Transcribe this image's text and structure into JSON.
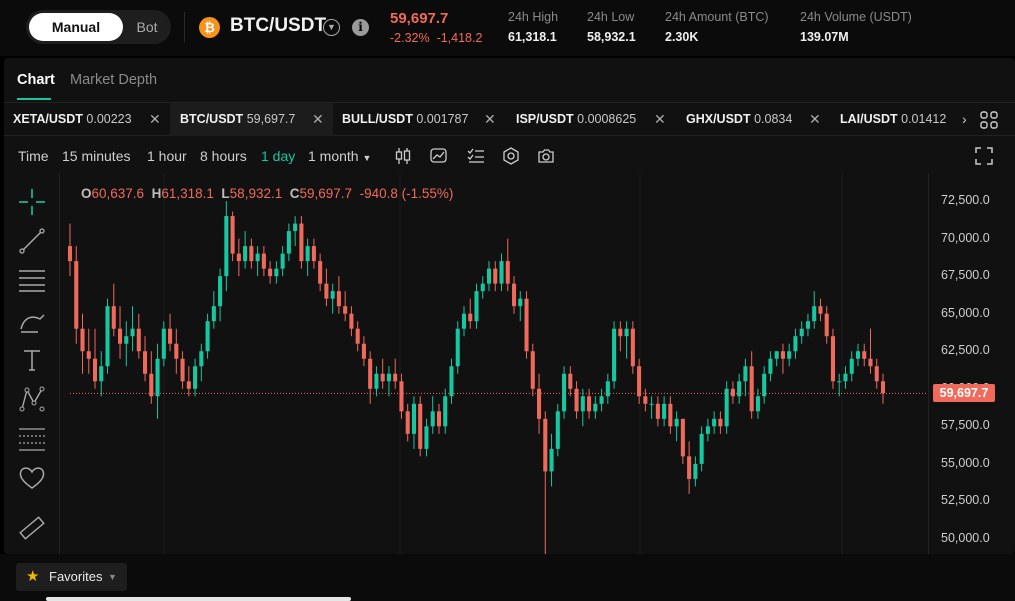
{
  "header": {
    "mode_toggle": {
      "manual": "Manual",
      "bot": "Bot"
    },
    "coin_glyph": "₿",
    "pair": "BTC/USDT",
    "last_price": "59,697.7",
    "change_pct": "-2.32%",
    "change_abs": "-1,418.2",
    "stats": [
      {
        "label": "24h High",
        "value": "61,318.1"
      },
      {
        "label": "24h Low",
        "value": "58,932.1"
      },
      {
        "label": "24h Amount (BTC)",
        "value": "2.30K"
      },
      {
        "label": "24h Volume (USDT)",
        "value": "139.07M"
      }
    ]
  },
  "view_tabs": {
    "chart": "Chart",
    "depth": "Market Depth"
  },
  "pair_tabs": [
    {
      "symbol": "XETA/USDT",
      "price": "0.00223",
      "active": false
    },
    {
      "symbol": "BTC/USDT",
      "price": "59,697.7",
      "active": true
    },
    {
      "symbol": "BULL/USDT",
      "price": "0.001787",
      "active": false
    },
    {
      "symbol": "ISP/USDT",
      "price": "0.0008625",
      "active": false
    },
    {
      "symbol": "GHX/USDT",
      "price": "0.0834",
      "active": false
    },
    {
      "symbol": "LAI/USDT",
      "price": "0.01412",
      "active": false
    }
  ],
  "toolbar": {
    "time_label": "Time",
    "timeframes": [
      "15 minutes",
      "1 hour",
      "8 hours",
      "1 day",
      "1 month"
    ],
    "active_timeframe": "1 day",
    "icons": [
      "candle-type-icon",
      "indicator-icon",
      "settings-list-icon",
      "gear-icon",
      "camera-icon",
      "fullscreen-icon"
    ]
  },
  "ohlc": {
    "o_label": "O",
    "o": "60,637.6",
    "h_label": "H",
    "h": "61,318.1",
    "l_label": "L",
    "l": "58,932.1",
    "c_label": "C",
    "c": "59,697.7",
    "chg": "-940.8 (-1.55%)"
  },
  "colors": {
    "up": "#16c8a0",
    "down": "#f06a5c",
    "accent": "#16c8a0",
    "bg": "#111111"
  },
  "price_axis": {
    "labels": [
      "72,500.0",
      "70,000.0",
      "67,500.0",
      "65,000.0",
      "62,500.0",
      "60,000.0",
      "57,500.0",
      "55,000.0",
      "52,500.0",
      "50,000.0"
    ],
    "current": "59,697.7",
    "current_value": 59697.7
  },
  "chart_data": {
    "type": "candlestick",
    "ylim": [
      49000,
      74300
    ],
    "candles": [
      [
        69500,
        71000,
        67500,
        68500
      ],
      [
        68500,
        69500,
        63000,
        64000
      ],
      [
        64000,
        65000,
        61000,
        62500
      ],
      [
        62500,
        64000,
        61000,
        62000
      ],
      [
        62000,
        64000,
        60000,
        60500
      ],
      [
        60500,
        62500,
        59500,
        61500
      ],
      [
        61500,
        66000,
        61000,
        65500
      ],
      [
        65500,
        67000,
        63500,
        64000
      ],
      [
        64000,
        65500,
        62000,
        63000
      ],
      [
        63000,
        64500,
        61500,
        63500
      ],
      [
        63500,
        65500,
        62500,
        64000
      ],
      [
        64000,
        65000,
        62000,
        62500
      ],
      [
        62500,
        63500,
        60500,
        61000
      ],
      [
        61000,
        62500,
        59000,
        59500
      ],
      [
        59500,
        63000,
        58000,
        62000
      ],
      [
        62000,
        64500,
        61500,
        64000
      ],
      [
        64000,
        65000,
        62500,
        63000
      ],
      [
        63000,
        64000,
        61000,
        62000
      ],
      [
        62000,
        62500,
        60000,
        60500
      ],
      [
        60500,
        61500,
        59500,
        60000
      ],
      [
        60000,
        62000,
        59500,
        61500
      ],
      [
        61500,
        63000,
        60500,
        62500
      ],
      [
        62500,
        65000,
        62000,
        64500
      ],
      [
        64500,
        66500,
        64000,
        65500
      ],
      [
        65500,
        68000,
        64500,
        67500
      ],
      [
        67500,
        72500,
        66500,
        71500
      ],
      [
        71500,
        71800,
        68500,
        69000
      ],
      [
        69000,
        70000,
        67500,
        68500
      ],
      [
        68500,
        70500,
        68000,
        69500
      ],
      [
        69500,
        70000,
        68000,
        68500
      ],
      [
        68500,
        69500,
        67500,
        69000
      ],
      [
        69000,
        69500,
        67500,
        68000
      ],
      [
        68000,
        68500,
        67000,
        67500
      ],
      [
        67500,
        68500,
        67000,
        68000
      ],
      [
        68000,
        69500,
        67500,
        69000
      ],
      [
        69000,
        71000,
        68500,
        70500
      ],
      [
        70500,
        71500,
        69500,
        71000
      ],
      [
        71000,
        71500,
        68000,
        68500
      ],
      [
        68500,
        70000,
        67500,
        69500
      ],
      [
        69500,
        70000,
        68000,
        68500
      ],
      [
        68500,
        69000,
        66500,
        67000
      ],
      [
        67000,
        68000,
        65500,
        66000
      ],
      [
        66000,
        67000,
        65000,
        66500
      ],
      [
        66500,
        67500,
        65000,
        65500
      ],
      [
        65500,
        66500,
        64500,
        65000
      ],
      [
        65000,
        65500,
        63500,
        64000
      ],
      [
        64000,
        64500,
        62500,
        63000
      ],
      [
        63000,
        63500,
        61500,
        62000
      ],
      [
        62000,
        62500,
        59000,
        60000
      ],
      [
        60000,
        61500,
        59500,
        61000
      ],
      [
        61000,
        62000,
        60000,
        60500
      ],
      [
        60500,
        61500,
        59500,
        61000
      ],
      [
        61000,
        62000,
        60000,
        60500
      ],
      [
        60500,
        61000,
        58000,
        58500
      ],
      [
        58500,
        59000,
        56500,
        57000
      ],
      [
        57000,
        59500,
        56000,
        59000
      ],
      [
        59000,
        59500,
        55500,
        56000
      ],
      [
        56000,
        58000,
        55500,
        57500
      ],
      [
        57500,
        59500,
        57000,
        58500
      ],
      [
        58500,
        59000,
        57000,
        57500
      ],
      [
        57500,
        60000,
        57000,
        59500
      ],
      [
        59500,
        62000,
        59000,
        61500
      ],
      [
        61500,
        64500,
        61000,
        64000
      ],
      [
        64000,
        65500,
        63500,
        65000
      ],
      [
        65000,
        66000,
        64000,
        64500
      ],
      [
        64500,
        67000,
        64000,
        66500
      ],
      [
        66500,
        67500,
        66000,
        67000
      ],
      [
        67000,
        68500,
        66500,
        68000
      ],
      [
        68000,
        68500,
        66500,
        67000
      ],
      [
        67000,
        69000,
        66500,
        68500
      ],
      [
        68500,
        70000,
        66500,
        67000
      ],
      [
        67000,
        67500,
        65000,
        65500
      ],
      [
        65500,
        66500,
        64500,
        66000
      ],
      [
        66000,
        66500,
        62000,
        62500
      ],
      [
        62500,
        63000,
        59500,
        60000
      ],
      [
        60000,
        61000,
        57000,
        58000
      ],
      [
        58000,
        58500,
        49000,
        54500
      ],
      [
        54500,
        57000,
        53500,
        56000
      ],
      [
        56000,
        59000,
        55500,
        58500
      ],
      [
        58500,
        61500,
        58000,
        61000
      ],
      [
        61000,
        61500,
        59500,
        60000
      ],
      [
        60000,
        60500,
        58000,
        58500
      ],
      [
        58500,
        60000,
        57500,
        59500
      ],
      [
        59500,
        60000,
        58000,
        58500
      ],
      [
        58500,
        59500,
        58000,
        59000
      ],
      [
        59000,
        60000,
        58500,
        59500
      ],
      [
        59500,
        61000,
        59000,
        60500
      ],
      [
        60500,
        64500,
        60000,
        64000
      ],
      [
        64000,
        64500,
        62500,
        63500
      ],
      [
        63500,
        64500,
        62000,
        64000
      ],
      [
        64000,
        64500,
        61000,
        61500
      ],
      [
        61500,
        62000,
        59000,
        59500
      ],
      [
        59500,
        60000,
        58500,
        59000
      ],
      [
        59000,
        59500,
        58000,
        59000
      ],
      [
        59000,
        59500,
        57500,
        58000
      ],
      [
        58000,
        59500,
        57500,
        59000
      ],
      [
        59000,
        59500,
        57000,
        57500
      ],
      [
        57500,
        58500,
        56500,
        58000
      ],
      [
        58000,
        58000,
        55000,
        55500
      ],
      [
        55500,
        56500,
        53000,
        54000
      ],
      [
        54000,
        55500,
        53500,
        55000
      ],
      [
        55000,
        57500,
        54500,
        57000
      ],
      [
        57000,
        58000,
        56500,
        57500
      ],
      [
        57500,
        58500,
        57000,
        58000
      ],
      [
        58000,
        58500,
        57000,
        57500
      ],
      [
        57500,
        60500,
        57000,
        60000
      ],
      [
        60000,
        60500,
        59000,
        59500
      ],
      [
        59500,
        61000,
        59000,
        60500
      ],
      [
        60500,
        62000,
        59500,
        61500
      ],
      [
        61500,
        62500,
        58000,
        58500
      ],
      [
        58500,
        60000,
        58000,
        59500
      ],
      [
        59500,
        61500,
        59000,
        61000
      ],
      [
        61000,
        62500,
        60500,
        62000
      ],
      [
        62000,
        62500,
        61500,
        62500
      ],
      [
        62500,
        63000,
        61000,
        62000
      ],
      [
        62000,
        63000,
        61500,
        62500
      ],
      [
        62500,
        64000,
        62000,
        63500
      ],
      [
        63500,
        64500,
        63000,
        64000
      ],
      [
        64000,
        65000,
        63500,
        64500
      ],
      [
        64500,
        66500,
        64000,
        65500
      ],
      [
        65500,
        66000,
        64500,
        65000
      ],
      [
        65000,
        65500,
        63000,
        63500
      ],
      [
        63500,
        64000,
        60000,
        60500
      ],
      [
        60500,
        61000,
        59500,
        60500
      ],
      [
        60500,
        61500,
        60000,
        61000
      ],
      [
        61000,
        62500,
        60500,
        62000
      ],
      [
        62000,
        63000,
        61500,
        62500
      ],
      [
        62500,
        63000,
        61500,
        62000
      ],
      [
        62000,
        64000,
        61000,
        61500
      ],
      [
        61500,
        62000,
        60000,
        60500
      ],
      [
        60500,
        61000,
        59000,
        59700
      ]
    ]
  },
  "left_tools": [
    "crosshair-tool-icon",
    "trend-line-tool-icon",
    "horizontal-lines-tool-icon",
    "brush-tool-icon",
    "text-tool-icon",
    "pattern-tool-icon",
    "fib-tool-icon",
    "favorite-heart-icon",
    "ruler-tool-icon"
  ],
  "footer": {
    "favorites": "Favorites"
  }
}
